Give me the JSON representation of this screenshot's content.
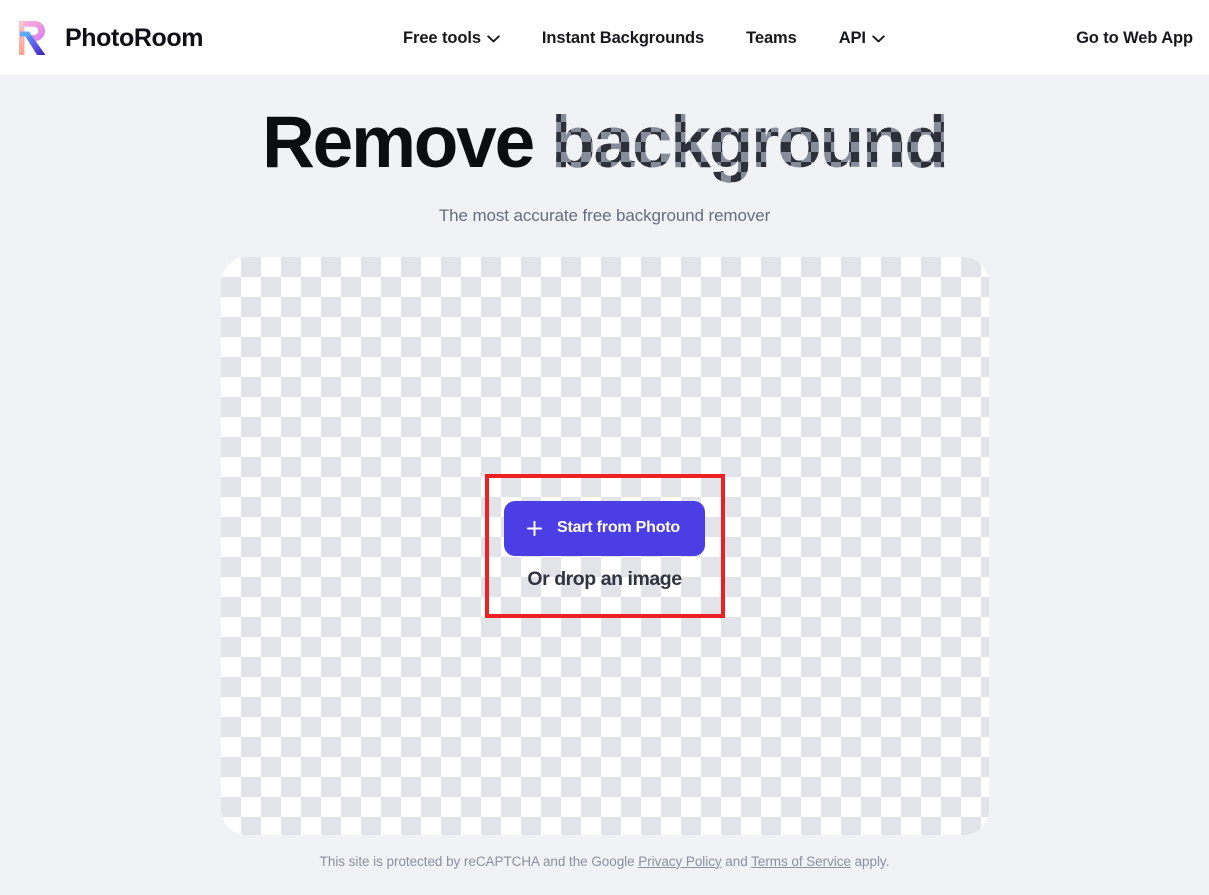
{
  "header": {
    "brand": {
      "name": "PhotoRoom",
      "logo_icon": "photoroom-r-logo-icon"
    },
    "nav": [
      {
        "label": "Free tools",
        "has_chevron": true,
        "icon": "chevron-down-icon"
      },
      {
        "label": "Instant Backgrounds",
        "has_chevron": false
      },
      {
        "label": "Teams",
        "has_chevron": false
      },
      {
        "label": "API",
        "has_chevron": true,
        "icon": "chevron-down-icon"
      }
    ],
    "web_app_link": "Go to Web App"
  },
  "hero": {
    "title_plain": "Remove ",
    "title_checker": "background",
    "subtitle": "The most accurate free background remover"
  },
  "dropzone": {
    "start_button": {
      "label": "Start from Photo",
      "icon": "plus-icon"
    },
    "drop_hint": "Or drop an image",
    "highlight_color": "#ed2024"
  },
  "footer": {
    "prefix": "This site is protected by reCAPTCHA and the Google ",
    "privacy_link": "Privacy Policy",
    "middle": " and ",
    "terms_link": "Terms of Service",
    "suffix": " apply."
  },
  "colors": {
    "page_background": "#f1f2f6",
    "header_background": "#ffffff",
    "accent_purple": "#4b3ee4",
    "highlight_red": "#ed2024",
    "checker_light": "#ffffff",
    "checker_dark": "#e3e4e9",
    "text_primary": "#0b0d11",
    "text_muted": "#676d7d",
    "footer_text": "#8b90a0"
  }
}
